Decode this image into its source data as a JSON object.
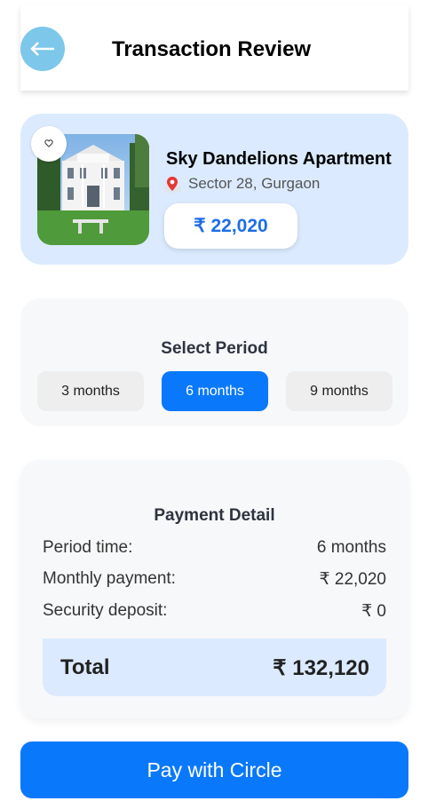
{
  "header": {
    "title": "Transaction Review",
    "back_icon": "arrow-left-icon"
  },
  "property": {
    "name": "Sky Dandelions Apartment",
    "location": "Sector 28, Gurgaon",
    "price": "₹ 22,020",
    "favorite_icon": "heart-icon",
    "location_icon": "map-pin-icon"
  },
  "period": {
    "title": "Select Period",
    "options": [
      "3 months",
      "6 months",
      "9 months"
    ],
    "selected": "6 months"
  },
  "payment": {
    "title": "Payment Detail",
    "rows": [
      {
        "label": "Period time:",
        "value": "6 months"
      },
      {
        "label": "Monthly payment:",
        "value": "₹ 22,020"
      },
      {
        "label": "Security deposit:",
        "value": "₹ 0"
      }
    ],
    "total_label": "Total",
    "total_value": "₹ 132,120"
  },
  "pay_button": "Pay with Circle",
  "colors": {
    "accent": "#0a78fb",
    "light_blue": "#dbeafe",
    "back_button": "#7cc7ea"
  }
}
